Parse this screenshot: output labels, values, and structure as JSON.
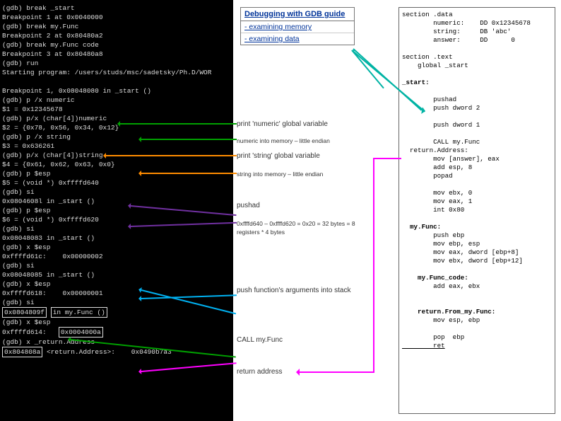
{
  "terminal": {
    "l1": "(gdb) break _start",
    "l2": "Breakpoint 1 at 0x0040000",
    "l3": "(gdb) break my.Func",
    "l4": "Breakpoint 2 at 0x80480a2",
    "l5": "(gdb) break my.Func code",
    "l6": "Breakpoint 3 at 0x80480a8",
    "l7": "(gdb) run",
    "l8": "Starting program: /users/studs/msc/sadetsky/Ph.D/WOR",
    "l9": "",
    "l10": "Breakpoint 1, 0x08048080 in _start ()",
    "l11": "(gdb) p /x numeric",
    "l12": "$1 = 0x12345678",
    "l13": "(gdb) p/x (char[4])numeric",
    "l14": "$2 = {0x78, 0x56, 0x34, 0x12}",
    "l15": "(gdb) p /x string",
    "l16": "$3 = 0x636261",
    "l17": "(gdb) p/x (char[4])string",
    "l18": "$4 = {0x61, 0x62, 0x63, 0x0}",
    "l19": "(gdb) p $esp",
    "l20": "$5 = (void *) 0xffffd640",
    "l21": "(gdb) si",
    "l22": "0x0804608l in _start ()",
    "l23": "(gdb) p $esp",
    "l24": "$6 = (void *) 0xffffd620",
    "l25": "(gdb) si",
    "l26": "0x08048083 in _start ()",
    "l27": "(gdb) x $esp",
    "l28": "0xffffd61c:    0x00000002",
    "l29": "(gdb) si",
    "l30": "0x08048085 in _start ()",
    "l31": "(gdb) x $esp",
    "l32": "0xffffd618:    0x00000001",
    "l33": "(gdb) si",
    "l34b1": "0x0804809f",
    "l34b2": "in my.Func ()",
    "l35": "(gdb) x $esp",
    "l36a": "0xffffd614:   ",
    "l36b": "0x0004000a",
    "l37": "(gdb) x _return.Address",
    "l38a": "0x804808a",
    "l38b": "<return.Address>:",
    "l38c": "    0x0490b7a3"
  },
  "guide": {
    "title": "Debugging with GDB guide",
    "item1": "- examining memory",
    "item2": "- examining data"
  },
  "annotations": {
    "printNumeric": "print 'numeric' global variable",
    "numericMem": "numeric into memory – little endian",
    "printString": "print 'string' global variable",
    "stringMem": "string into memory – little endian",
    "pushad": "pushad",
    "stackMath": "0xffffd640 – 0xffffd620 = 0x20 = 32 bytes = 8 registers * 4 bytes",
    "pushArgs": "push function's arguments into stack",
    "callFunc": "CALL my.Func",
    "retAddr": "return address"
  },
  "code": {
    "l1": "section .data",
    "l2": "        numeric:    DD 0x12345678",
    "l3": "        string:     DB 'abc'",
    "l4": "        answer:     DD      0",
    "l5": "",
    "l6": "section .text",
    "l7": "    global _start",
    "l8": "",
    "l9_bold": "_start:",
    "l10": "",
    "l11": "        pushad",
    "l12": "        push dword 2",
    "l13": "",
    "l14": "        push dword 1",
    "l15": "",
    "l16": "        CALL my.Func",
    "l17": "  return.Address:",
    "l18": "        mov [answer], eax",
    "l19": "        add esp, 8",
    "l20": "        popad",
    "l21": "",
    "l22": "        mov ebx, 0",
    "l23": "        mov eax, 1",
    "l24": "        int 0x80",
    "l25": "",
    "l26_bold": "  my.Func:",
    "l27": "        push ebp",
    "l28": "        mov ebp, esp",
    "l29": "        mov eax, dword [ebp+8]",
    "l30": "        mov ebx, dword [ebp+12]",
    "l31": "",
    "l32_bold": "    my.Func_code:",
    "l33": "        add eax, ebx",
    "l34": "",
    "l35": "",
    "l36_bold": "    return.From_my.Func:",
    "l37": "        mov esp, ebp",
    "l38": "",
    "l39": "        pop  ebp",
    "l40": "        ret"
  }
}
